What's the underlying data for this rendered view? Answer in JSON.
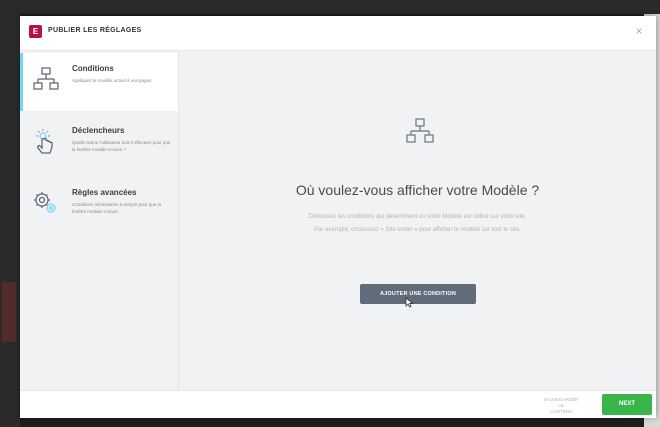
{
  "modal": {
    "title": "PUBLIER LES RÉGLAGES",
    "logo_text": "E",
    "close_label": "×",
    "brand_color": "#b5104a"
  },
  "sidebar": {
    "items": [
      {
        "title": "Conditions",
        "description": "Appliquez le modèle actuel à vos pages.",
        "icon": "sitemap-icon",
        "active": true
      },
      {
        "title": "Déclencheurs",
        "description": "Quelle action l'utilisateur doit-il effectuer pour que la fenêtre modale s'ouvre ?",
        "icon": "pointer-click-icon",
        "active": false
      },
      {
        "title": "Règles avancées",
        "description": "Conditions nécessaires à remplir pour que la fenêtre modale s'ouvre.",
        "icon": "gears-icon",
        "active": false
      }
    ]
  },
  "main": {
    "icon": "sitemap-icon",
    "heading": "Où voulez-vous afficher votre Modèle ?",
    "description_line1": "Définissez les conditions qui déterminent où votre Modèle est utilisé sur votre site.",
    "description_line2": "Par exemple, choisissez « Site entier » pour afficher le modèle sur tout le site.",
    "add_condition_label": "AJOUTER UNE CONDITION"
  },
  "footer": {
    "save_draft_line1": "SAUVEGARDER LE",
    "save_draft_line2": "CONTENU",
    "next_label": "NEXT",
    "next_color": "#39b54a"
  }
}
